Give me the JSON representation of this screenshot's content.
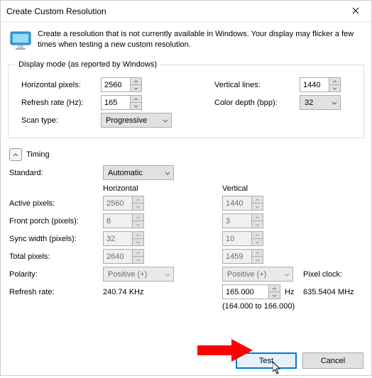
{
  "window": {
    "title": "Create Custom Resolution"
  },
  "info": "Create a resolution that is not currently available in Windows. Your display may flicker a few times when testing a new custom resolution.",
  "display_mode": {
    "legend": "Display mode (as reported by Windows)",
    "hp_label": "Horizontal pixels:",
    "hp_value": "2560",
    "vl_label": "Vertical lines:",
    "vl_value": "1440",
    "rr_label": "Refresh rate (Hz):",
    "rr_value": "165",
    "cd_label": "Color depth (bpp):",
    "cd_value": "32",
    "st_label": "Scan type:",
    "st_value": "Progressive"
  },
  "timing": {
    "toggle_label": "Timing",
    "std_label": "Standard:",
    "std_value": "Automatic",
    "h_head": "Horizontal",
    "v_head": "Vertical",
    "ap_label": "Active pixels:",
    "ap_h": "2560",
    "ap_v": "1440",
    "fp_label": "Front porch (pixels):",
    "fp_h": "8",
    "fp_v": "3",
    "sw_label": "Sync width (pixels):",
    "sw_h": "32",
    "sw_v": "10",
    "tp_label": "Total pixels:",
    "tp_h": "2640",
    "tp_v": "1459",
    "pol_label": "Polarity:",
    "pol_h": "Positive (+)",
    "pol_v": "Positive (+)",
    "rr_label": "Refresh rate:",
    "rr_h": "240.74 KHz",
    "rr_v": "165.000",
    "rr_v_unit": "Hz",
    "rr_range": "(164.000 to 166.000)",
    "pclk_label": "Pixel clock:",
    "pclk_value": "635.5404 MHz"
  },
  "footer": {
    "test": "Test",
    "cancel": "Cancel"
  }
}
